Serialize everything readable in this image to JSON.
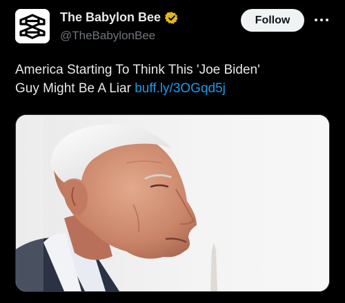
{
  "author": {
    "display_name": "The Babylon Bee",
    "handle": "@TheBabylonBee",
    "verified": true,
    "avatar_icon": "babylon-bee-logo-icon"
  },
  "actions": {
    "follow_label": "Follow",
    "more_icon": "more-horizontal-icon"
  },
  "tweet": {
    "text_line1": "America Starting To Think This 'Joe Biden'",
    "text_line2": "Guy Might Be A Liar",
    "link_text": "buff.ly/3OGqd5j"
  },
  "colors": {
    "background": "#000000",
    "text": "#e7e9ea",
    "secondary_text": "#71767b",
    "link": "#1d9bf0",
    "verified_badge": "#e2b719",
    "follow_button_bg": "#eff3f4"
  }
}
